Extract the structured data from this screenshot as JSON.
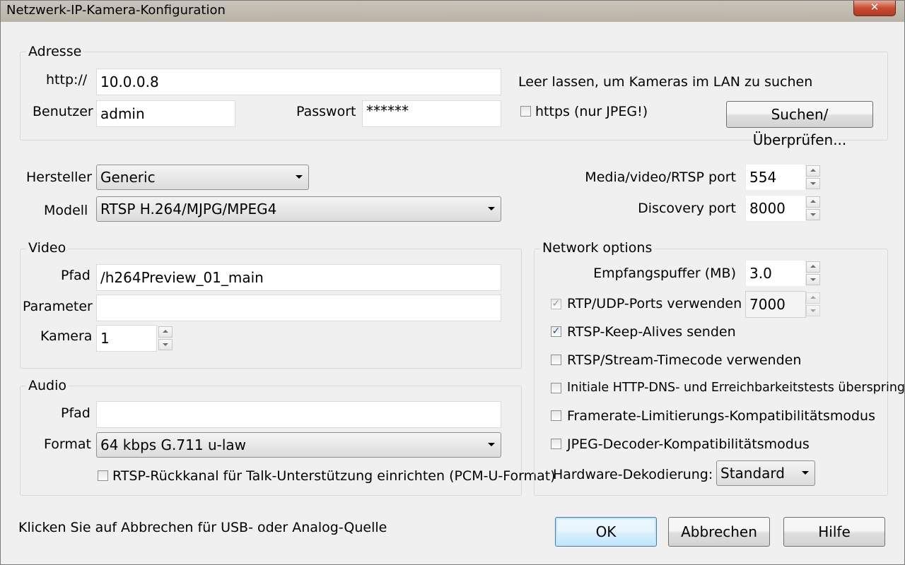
{
  "window": {
    "title": "Netzwerk-IP-Kamera-Konfiguration",
    "close_glyph": "✕"
  },
  "adresse": {
    "group_label": "Adresse",
    "url_label": "http://",
    "url_value": "10.0.0.8",
    "hint": "Leer lassen, um Kameras im LAN zu suchen",
    "user_label": "Benutzer",
    "user_value": "admin",
    "password_label": "Passwort",
    "password_value": "******",
    "https_label": "https (nur JPEG!)",
    "https_checked": false,
    "search_button": "Suchen/Überprüfen..."
  },
  "device": {
    "manufacturer_label": "Hersteller",
    "manufacturer_value": "Generic",
    "model_label": "Modell",
    "model_value": "RTSP H.264/MJPG/MPEG4",
    "rtsp_port_label": "Media/video/RTSP port",
    "rtsp_port_value": "554",
    "discovery_port_label": "Discovery port",
    "discovery_port_value": "8000"
  },
  "video": {
    "group_label": "Video",
    "path_label": "Pfad",
    "path_value": "/h264Preview_01_main",
    "params_label": "Parameter",
    "params_value": "",
    "camera_label": "Kamera",
    "camera_value": "1"
  },
  "audio": {
    "group_label": "Audio",
    "path_label": "Pfad",
    "path_value": "",
    "format_label": "Format",
    "format_value": "64 kbps G.711 u-law",
    "backchannel_label": "RTSP-Rückkanal für Talk-Unterstützung einrichten (PCM-U-Format)",
    "backchannel_checked": false
  },
  "network": {
    "group_label": "Network options",
    "buffer_label": "Empfangspuffer (MB)",
    "buffer_value": "3.0",
    "rtp_udp_label": "RTP/UDP-Ports verwenden",
    "rtp_udp_value": "7000",
    "options": [
      {
        "label": "RTSP-Keep-Alives senden",
        "checked": true
      },
      {
        "label": "RTSP/Stream-Timecode verwenden",
        "checked": false
      },
      {
        "label": "Initiale HTTP-DNS- und Erreichbarkeitstests überspringen",
        "checked": false
      },
      {
        "label": "Framerate-Limitierungs-Kompatibilitätsmodus",
        "checked": false
      },
      {
        "label": "JPEG-Decoder-Kompatibilitätsmodus",
        "checked": false
      }
    ],
    "hw_decode_label": "Hardware-Dekodierung:",
    "hw_decode_value": "Standard"
  },
  "footer": {
    "hint": "Klicken Sie auf Abbrechen für USB- oder Analog-Quelle",
    "ok": "OK",
    "cancel": "Abbrechen",
    "help": "Hilfe"
  },
  "check_glyph": "✓"
}
